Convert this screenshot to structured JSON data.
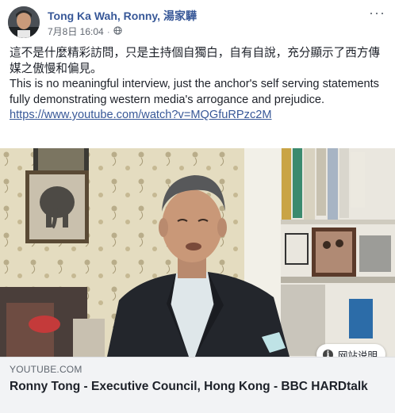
{
  "post": {
    "author": "Tong Ka Wah, Ronny, 湯家驊",
    "timestamp": "7月8日 16:04",
    "separator": "·",
    "privacy_icon": "globe-icon",
    "more_label": "···",
    "text_zh": "這不是什麼精彩訪問，只是主持個自獨白，自有自說，充分顯示了西方傳媒之傲慢和偏見。",
    "text_en": "This is no meaningful interview, just the anchor's self serving statements fully demonstrating western media's arrogance and prejudice.",
    "url": "https://www.youtube.com/watch?v=MQGfuRPzc2M"
  },
  "video": {
    "info_icon": "info-icon",
    "info_label": "网站说明"
  },
  "link_preview": {
    "domain": "YOUTUBE.COM",
    "title": "Ronny Tong - Executive Council, Hong Kong - BBC HARDtalk"
  },
  "colors": {
    "link_blue": "#385898",
    "text": "#1d2129",
    "meta_gray": "#616770",
    "preview_bg": "#f2f3f5"
  }
}
